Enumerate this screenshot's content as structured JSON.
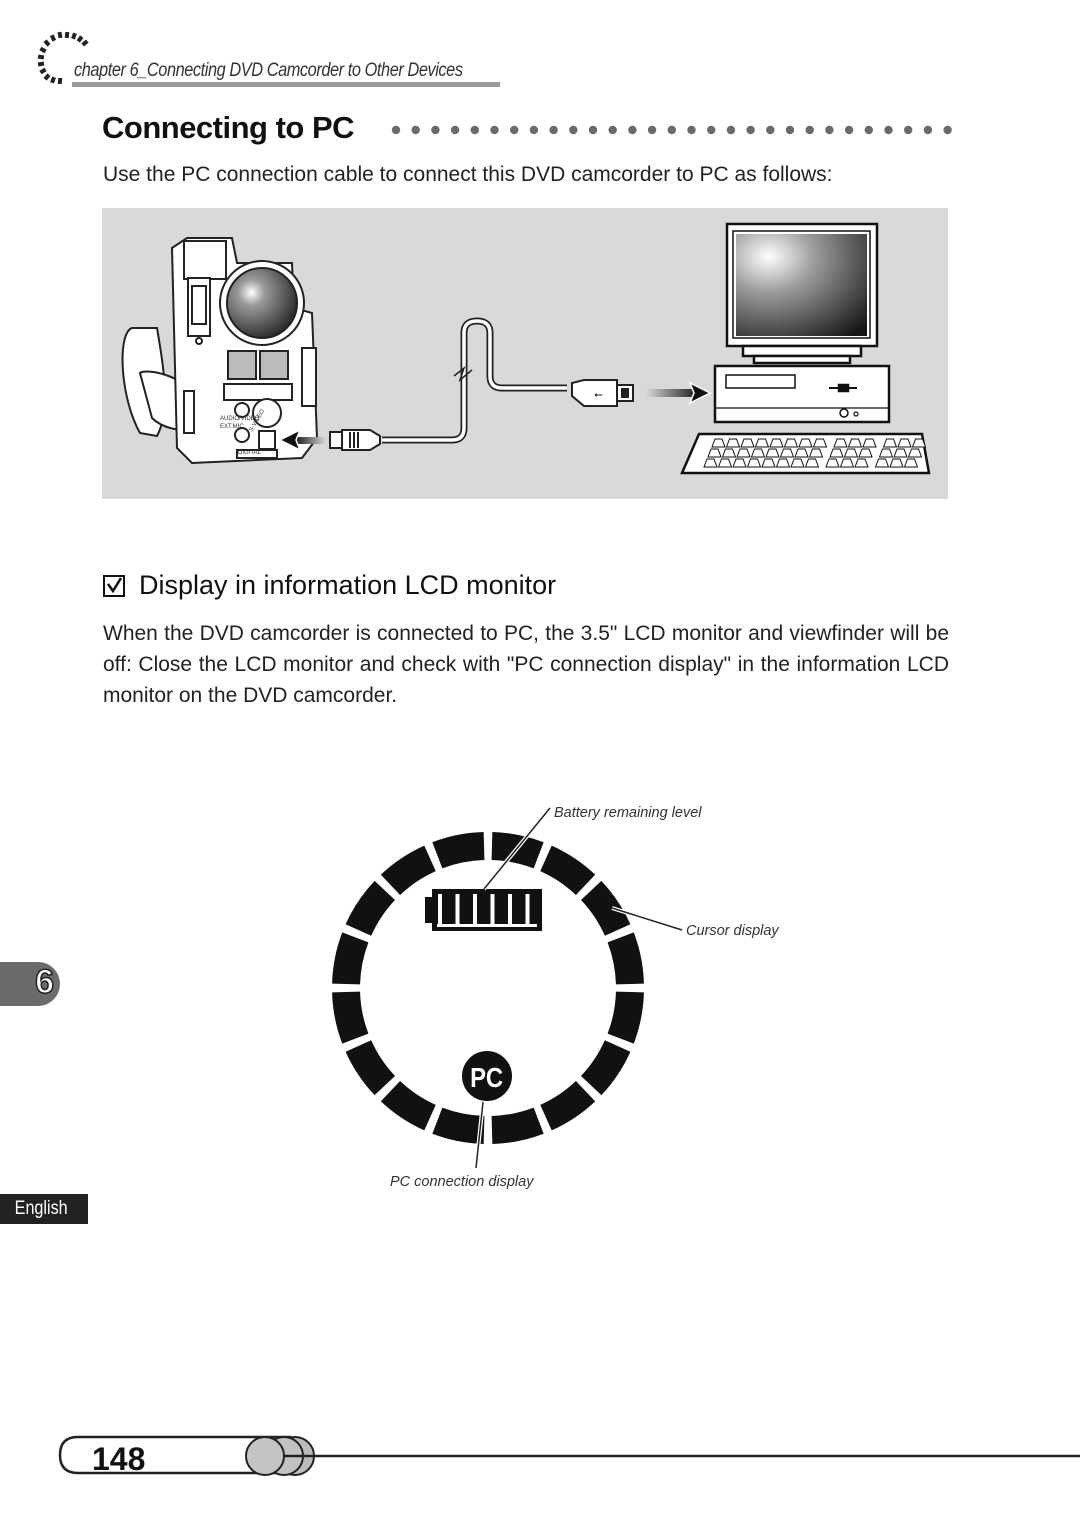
{
  "header": {
    "chapter_label": "chapter 6_Connecting DVD Camcorder to Other Devices"
  },
  "section": {
    "title": "Connecting to PC",
    "intro": "Use the PC connection cable to connect this DVD camcorder to PC as follows:"
  },
  "connection_diagram": {
    "camcorder_labels": [
      "AUDIO/VIDEO",
      "EXT.MIC",
      "S-VIDEO",
      "DIGITAL"
    ],
    "cable_symbol": "usb-icon"
  },
  "subsection": {
    "icon": "checkbox-checked-icon",
    "title": "Display in information LCD monitor",
    "body": "When the DVD camcorder is connected to PC, the 3.5\" LCD monitor and viewfinder will be off: Close the LCD monitor and check with \"PC connection display\" in the information LCD monitor on the DVD camcorder."
  },
  "lcd_figure": {
    "callouts": {
      "battery": "Battery remaining level",
      "cursor": "Cursor display",
      "pc": "PC connection display"
    },
    "pc_badge": "PC",
    "battery_bars_filled": 6,
    "battery_bars_total": 6,
    "ring_segments": 16
  },
  "side_tabs": {
    "chapter_number": "6",
    "language": "English"
  },
  "footer": {
    "page_number": "148"
  }
}
